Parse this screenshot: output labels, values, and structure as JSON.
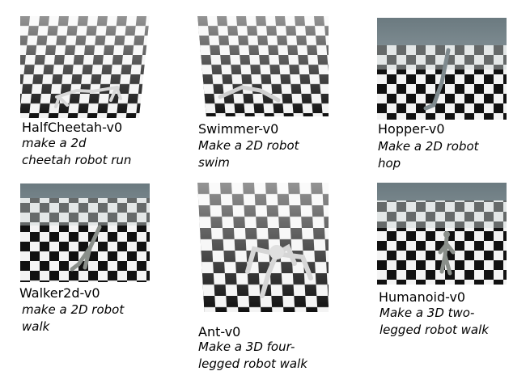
{
  "environments": [
    {
      "name": "HalfCheetah-v0",
      "desc_line1": "make a 2d",
      "desc_line2": "cheetah robot run",
      "robot": "cheetah-robot"
    },
    {
      "name": "Swimmer-v0",
      "desc_line1": "Make a 2D robot",
      "desc_line2": "swim",
      "robot": "swimmer-robot"
    },
    {
      "name": "Hopper-v0",
      "desc_line1": "Make a 2D robot",
      "desc_line2": "hop",
      "robot": "hopper-robot"
    },
    {
      "name": "Walker2d-v0",
      "desc_line1": "make a 2D robot",
      "desc_line2": "walk",
      "robot": "walker-robot"
    },
    {
      "name": "Ant-v0",
      "desc_line1": "Make a 3D four-",
      "desc_line2": "legged robot walk",
      "robot": "ant-robot"
    },
    {
      "name": "Humanoid-v0",
      "desc_line1": "Make a 3D two-",
      "desc_line2": "legged robot walk",
      "robot": "humanoid-robot"
    }
  ]
}
